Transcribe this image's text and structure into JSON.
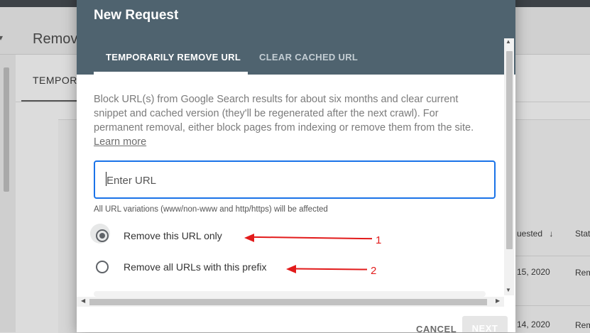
{
  "background": {
    "title": "Remov",
    "tab": "TEMPOR",
    "columns": {
      "requested": "uested",
      "status": "Stat"
    },
    "rows": [
      {
        "date": "15, 2020",
        "status": "Rem"
      },
      {
        "date": "14, 2020",
        "status": "Rem"
      }
    ]
  },
  "dialog": {
    "title": "New Request",
    "tabs": [
      {
        "label": "TEMPORARILY REMOVE URL",
        "active": true
      },
      {
        "label": "CLEAR CACHED URL",
        "active": false
      }
    ],
    "description": "Block URL(s) from Google Search results for about six months and clear current snippet and cached version (they'll be regenerated after the next crawl). For permanent removal, either block pages from indexing or remove them from the site.",
    "learn_more": "Learn more",
    "url_input": {
      "placeholder": "Enter URL",
      "value": ""
    },
    "helper_text": "All URL variations (www/non-www and http/https) will be affected",
    "options": [
      {
        "label": "Remove this URL only",
        "selected": true
      },
      {
        "label": "Remove all URLs with this prefix",
        "selected": false
      }
    ],
    "cancel_label": "CANCEL",
    "next_label": "NEXT"
  },
  "annotations": [
    {
      "number": "1"
    },
    {
      "number": "2"
    }
  ],
  "colors": {
    "header": "#4f636f",
    "focus": "#1a73e8",
    "annotation": "#e21b1b"
  },
  "icons": [
    "sort-down-arrow-icon",
    "chevron-down-icon",
    "scroll-up-icon",
    "scroll-down-icon",
    "scroll-left-icon",
    "scroll-right-icon"
  ]
}
